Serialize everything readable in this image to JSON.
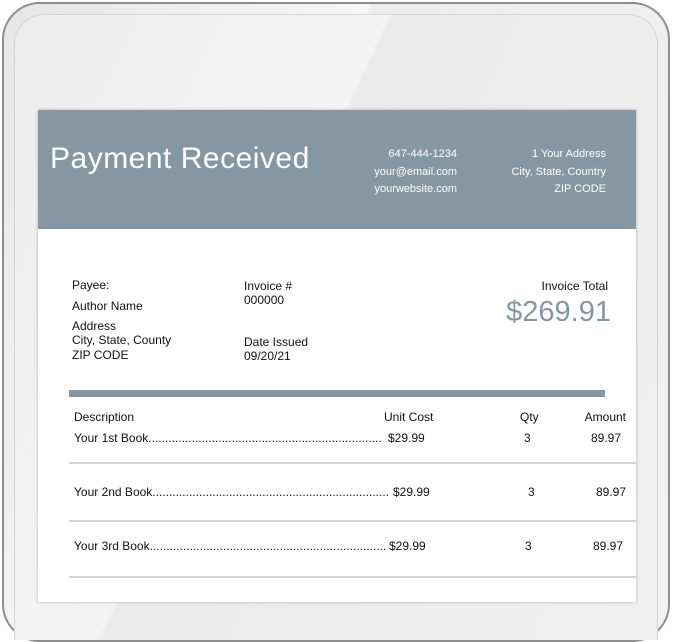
{
  "header": {
    "title": "Payment Received",
    "phone": "647-444-1234",
    "email": "your@email.com",
    "website": "yourwebsite.com",
    "address_line1": "1 Your Address",
    "address_line2": "City, State, Country",
    "address_line3": "ZIP CODE"
  },
  "payee": {
    "label": "Payee:",
    "name": "Author Name",
    "address_line1": "Address",
    "address_line2": "City, State, County",
    "address_line3": "ZIP CODE"
  },
  "invoice": {
    "number_label": "Invoice #",
    "number": "000000",
    "date_label": "Date Issued",
    "date": "09/20/21",
    "total_label": "Invoice Total",
    "total": "$269.91"
  },
  "table": {
    "headers": {
      "description": "Description",
      "unit_cost": "Unit Cost",
      "qty": "Qty",
      "amount": "Amount"
    },
    "rows": [
      {
        "description": "Your 1st Book......................................................................",
        "unit_cost": "$29.99",
        "qty": "3",
        "amount": "89.97"
      },
      {
        "description": "Your 2nd Book.......................................................................",
        "unit_cost": "$29.99",
        "qty": "3",
        "amount": "89.97"
      },
      {
        "description": "Your 3rd Book.......................................................................",
        "unit_cost": "$29.99",
        "qty": "3",
        "amount": "89.97"
      }
    ]
  },
  "colors": {
    "accent": "#8597a2",
    "divider": "#d6d6d6"
  }
}
